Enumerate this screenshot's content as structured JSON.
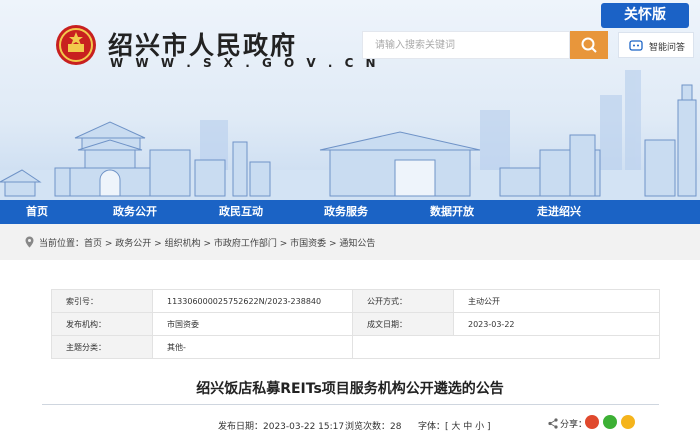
{
  "site": {
    "title": "绍兴市人民政府",
    "url": "W W W . S X . G O V . C N"
  },
  "search": {
    "placeholder": "请输入搜索关键词"
  },
  "care_mode": "关怀版",
  "assistant": "智能问答",
  "nav": [
    "首页",
    "政务公开",
    "政民互动",
    "政务服务",
    "数据开放",
    "走进绍兴"
  ],
  "breadcrumb": {
    "label": "当前位置：",
    "items": [
      "首页",
      "政务公开",
      "组织机构",
      "市政府工作部门",
      "市国资委",
      "通知公告"
    ],
    "separator": " > "
  },
  "meta": {
    "index_label": "索引号：",
    "index_value": "113306000025752622N/2023-238840",
    "openness_label": "公开方式：",
    "openness_value": "主动公开",
    "publisher_label": "发布机构：",
    "publisher_value": "市国资委",
    "date_label": "成文日期：",
    "date_value": "2023-03-22",
    "topic_label": "主题分类：",
    "topic_value": "其他-"
  },
  "article": {
    "title": "绍兴饭店私募REITs项目服务机构公开遴选的公告",
    "publish_time": "发布日期：2023-03-22 15:17",
    "views": "浏览次数：28",
    "font_size": "字体：[ 大 中 小 ]",
    "share_label": "分享："
  },
  "colors": {
    "brand_blue": "#1b63c5",
    "search_orange": "#e8963b"
  },
  "icons": [
    "emblem-icon",
    "search-icon",
    "robot-icon",
    "location-icon",
    "weibo-icon",
    "wechat-icon",
    "qzone-icon"
  ]
}
